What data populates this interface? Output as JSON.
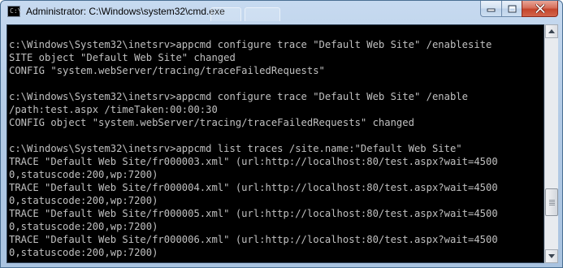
{
  "window": {
    "title": "Administrator: C:\\Windows\\system32\\cmd.exe",
    "icon": "cmd-icon"
  },
  "caption_buttons": {
    "minimize_icon": "minimize-icon",
    "maximize_icon": "maximize-icon",
    "close_icon": "close-icon"
  },
  "console": {
    "background": "#000000",
    "foreground": "#c0c0c0",
    "lines": [
      "c:\\Windows\\System32\\inetsrv>appcmd configure trace \"Default Web Site\" /enablesite",
      "SITE object \"Default Web Site\" changed",
      "CONFIG \"system.webServer/tracing/traceFailedRequests\"",
      "",
      "c:\\Windows\\System32\\inetsrv>appcmd configure trace \"Default Web Site\" /enable",
      "/path:test.aspx /timeTaken:00:00:30",
      "CONFIG object \"system.webServer/tracing/traceFailedRequests\" changed",
      "",
      "c:\\Windows\\System32\\inetsrv>appcmd list traces /site.name:\"Default Web Site\"",
      "TRACE \"Default Web Site/fr000003.xml\" (url:http://localhost:80/test.aspx?wait=4500",
      "0,statuscode:200,wp:7200)",
      "TRACE \"Default Web Site/fr000004.xml\" (url:http://localhost:80/test.aspx?wait=4500",
      "0,statuscode:200,wp:7200)",
      "TRACE \"Default Web Site/fr000005.xml\" (url:http://localhost:80/test.aspx?wait=4500",
      "0,statuscode:200,wp:7200)",
      "TRACE \"Default Web Site/fr000006.xml\" (url:http://localhost:80/test.aspx?wait=4500",
      "0,statuscode:200,wp:7200)"
    ]
  },
  "scrollbar": {
    "up_icon": "scroll-up-arrow-icon",
    "down_icon": "scroll-down-arrow-icon",
    "position_fraction": 0.82,
    "visible_fraction": 0.13
  }
}
